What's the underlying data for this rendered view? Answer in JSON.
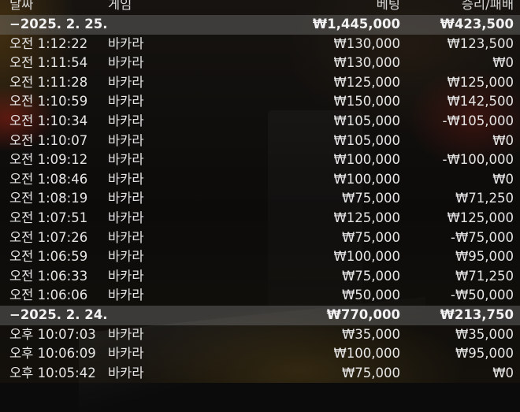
{
  "header": {
    "date": "날짜",
    "game": "게임",
    "bet": "베팅",
    "winloss": "승리/패배"
  },
  "groups": [
    {
      "date": "−2025. 2. 25.",
      "bet_total": "₩1,445,000",
      "winloss_total": "₩423,500",
      "rows": [
        {
          "time": "오전 1:12:22",
          "game": "바카라",
          "bet": "₩130,000",
          "winloss": "₩123,500"
        },
        {
          "time": "오전 1:11:54",
          "game": "바카라",
          "bet": "₩130,000",
          "winloss": "₩0"
        },
        {
          "time": "오전 1:11:28",
          "game": "바카라",
          "bet": "₩125,000",
          "winloss": "₩125,000"
        },
        {
          "time": "오전 1:10:59",
          "game": "바카라",
          "bet": "₩150,000",
          "winloss": "₩142,500"
        },
        {
          "time": "오전 1:10:34",
          "game": "바카라",
          "bet": "₩105,000",
          "winloss": "-₩105,000"
        },
        {
          "time": "오전 1:10:07",
          "game": "바카라",
          "bet": "₩105,000",
          "winloss": "₩0"
        },
        {
          "time": "오전 1:09:12",
          "game": "바카라",
          "bet": "₩100,000",
          "winloss": "-₩100,000"
        },
        {
          "time": "오전 1:08:46",
          "game": "바카라",
          "bet": "₩100,000",
          "winloss": "₩0"
        },
        {
          "time": "오전 1:08:19",
          "game": "바카라",
          "bet": "₩75,000",
          "winloss": "₩71,250"
        },
        {
          "time": "오전 1:07:51",
          "game": "바카라",
          "bet": "₩125,000",
          "winloss": "₩125,000"
        },
        {
          "time": "오전 1:07:26",
          "game": "바카라",
          "bet": "₩75,000",
          "winloss": "-₩75,000"
        },
        {
          "time": "오전 1:06:59",
          "game": "바카라",
          "bet": "₩100,000",
          "winloss": "₩95,000"
        },
        {
          "time": "오전 1:06:33",
          "game": "바카라",
          "bet": "₩75,000",
          "winloss": "₩71,250"
        },
        {
          "time": "오전 1:06:06",
          "game": "바카라",
          "bet": "₩50,000",
          "winloss": "-₩50,000"
        }
      ]
    },
    {
      "date": "−2025. 2. 24.",
      "bet_total": "₩770,000",
      "winloss_total": "₩213,750",
      "rows": [
        {
          "time": "오후 10:07:03",
          "game": "바카라",
          "bet": "₩35,000",
          "winloss": "₩35,000"
        },
        {
          "time": "오후 10:06:09",
          "game": "바카라",
          "bet": "₩100,000",
          "winloss": "₩95,000"
        },
        {
          "time": "오후 10:05:42",
          "game": "바카라",
          "bet": "₩75,000",
          "winloss": "₩0"
        }
      ]
    }
  ]
}
